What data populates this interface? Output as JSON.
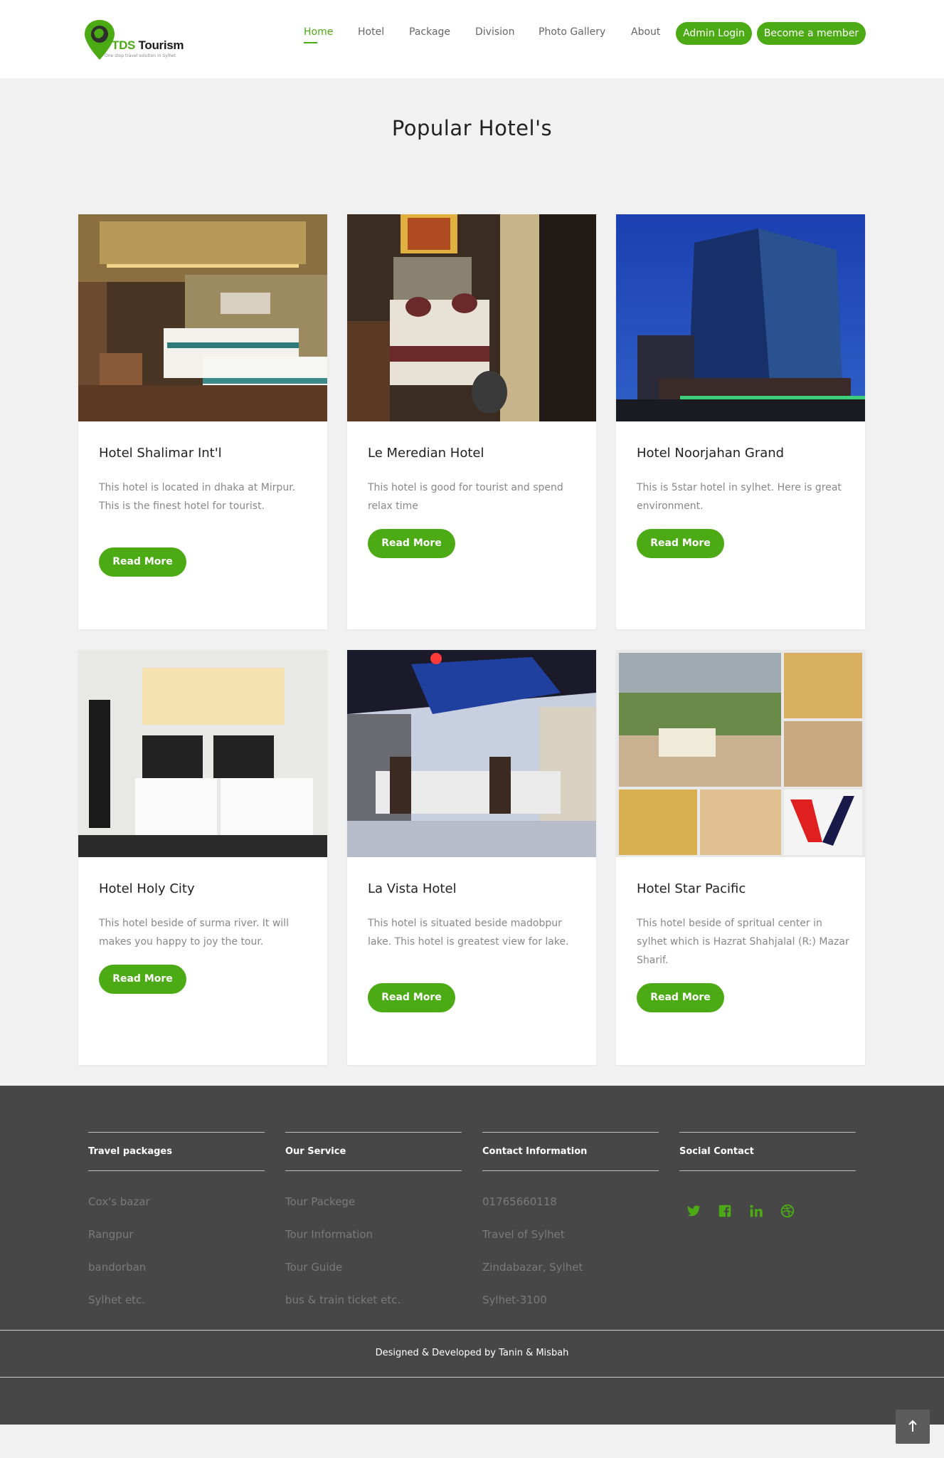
{
  "header": {
    "logo": {
      "brand": "TDS",
      "name": " Tourism",
      "tagline": "One stop travel solution in Sylhet"
    },
    "nav": [
      {
        "label": "Home",
        "active": true
      },
      {
        "label": "Hotel"
      },
      {
        "label": "Package"
      },
      {
        "label": "Division"
      },
      {
        "label": "Photo Gallery"
      },
      {
        "label": "About"
      }
    ],
    "admin_login": "Admin Login",
    "become_member": "Become a member"
  },
  "section": {
    "title": "Popular Hotel's"
  },
  "hotels": [
    {
      "name": "Hotel Shalimar Int'l",
      "description": "This hotel is located in dhaka at Mirpur. This is the finest hotel for tourist.",
      "button": "Read More"
    },
    {
      "name": "Le Meredian Hotel",
      "description": "This hotel is good for tourist and spend relax time",
      "button": "Read More"
    },
    {
      "name": "Hotel Noorjahan Grand",
      "description": "This is 5star hotel in sylhet. Here is great environment.",
      "button": "Read More"
    },
    {
      "name": "Hotel Holy City",
      "description": "This hotel beside of surma river. It will makes you happy to joy the tour.",
      "button": "Read More"
    },
    {
      "name": "La Vista Hotel",
      "description": "This hotel is situated beside madobpur lake. This hotel is greatest view for lake.",
      "button": "Read More"
    },
    {
      "name": "Hotel Star Pacific",
      "description": "This hotel beside of spritual center in sylhet which is Hazrat Shahjalal (R:) Mazar Sharif.",
      "button": "Read More"
    }
  ],
  "footer": {
    "columns": [
      {
        "heading": "Travel packages",
        "items": [
          "Cox's bazar",
          "Rangpur",
          "bandorban",
          "Sylhet etc."
        ]
      },
      {
        "heading": "Our Service",
        "items": [
          "Tour Packege",
          "Tour Information",
          "Tour Guide",
          "bus & train ticket etc."
        ]
      },
      {
        "heading": "Contact Information",
        "items": [
          "01765660118",
          "Travel of Sylhet",
          "Zindabazar, Sylhet",
          "Sylhet-3100"
        ]
      },
      {
        "heading": "Social Contact",
        "items": []
      }
    ],
    "social_icons": [
      "twitter-icon",
      "facebook-icon",
      "linkedin-icon",
      "dribbble-icon"
    ],
    "credit": "Designed & Developed by Tanin & Misbah"
  },
  "colors": {
    "accent": "#4caa14",
    "footer_bg": "#474747",
    "page_bg": "#f1f1f1"
  }
}
